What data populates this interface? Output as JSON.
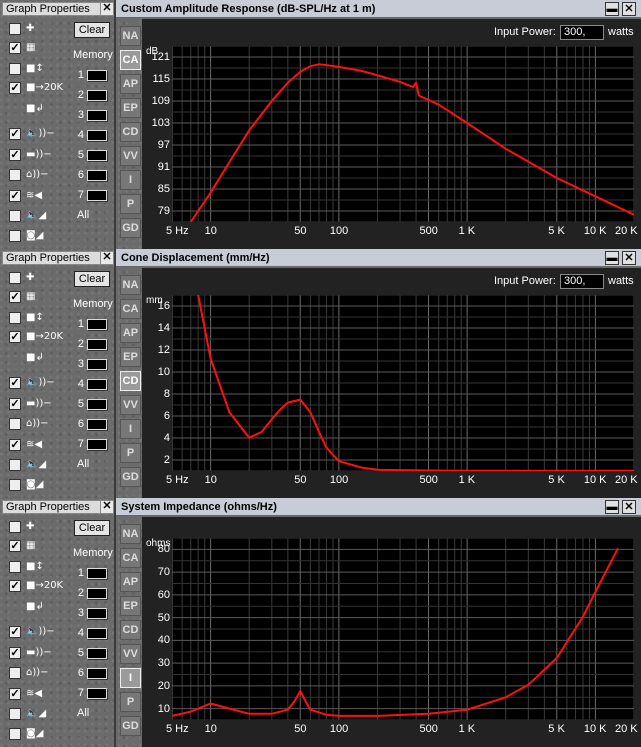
{
  "graph_properties": {
    "title": "Graph Properties",
    "close": "✕",
    "clear": "Clear",
    "memory": "Memory",
    "slots": [
      "1",
      "2",
      "3",
      "4",
      "5",
      "6",
      "7"
    ],
    "all": "All"
  },
  "tabs": [
    "NA",
    "CA",
    "AP",
    "EP",
    "CD",
    "VV",
    "I",
    "P",
    "GD"
  ],
  "window_buttons": {
    "minimize": "▬",
    "close": "✕"
  },
  "graph1": {
    "title": "Custom Amplitude Response (dB-SPL/Hz at 1 m)",
    "input_power_label": "Input Power:",
    "input_power_value": "300,",
    "unit": "watts",
    "yunit": "dB",
    "yticks": [
      "121",
      "115",
      "109",
      "103",
      "97",
      "91",
      "85",
      "79"
    ],
    "xticks": [
      "5 Hz",
      "10",
      "50",
      "100",
      "500",
      "1 K",
      "5 K",
      "10 K",
      "20 K"
    ]
  },
  "graph2": {
    "title": "Cone Displacement (mm/Hz)",
    "input_power_label": "Input Power:",
    "input_power_value": "300,",
    "unit": "watts",
    "yunit": "mm",
    "yticks": [
      "16",
      "14",
      "12",
      "10",
      "8",
      "6",
      "4",
      "2"
    ],
    "xticks": [
      "5 Hz",
      "10",
      "50",
      "100",
      "500",
      "1 K",
      "5 K",
      "10 K",
      "20 K"
    ]
  },
  "graph3": {
    "title": "System Impedance (ohms/Hz)",
    "yunit": "ohms",
    "yticks": [
      "80",
      "70",
      "60",
      "50",
      "40",
      "30",
      "20",
      "10"
    ],
    "xticks": [
      "5 Hz",
      "10",
      "50",
      "100",
      "500",
      "1 K",
      "5 K",
      "10 K",
      "20 K"
    ]
  },
  "colors": {
    "curve": "#ff1010",
    "grid": "#5a5a5a",
    "plot_bg": "#000000",
    "title_bar": "#c8ccd6"
  },
  "chart_data": [
    {
      "type": "line",
      "title": "Custom Amplitude Response (dB-SPL/Hz at 1 m)",
      "xlabel": "",
      "ylabel": "dB",
      "x_scale": "log",
      "xlim": [
        5,
        20000
      ],
      "ylim": [
        76,
        124
      ],
      "x": [
        7,
        10,
        15,
        20,
        30,
        40,
        50,
        60,
        70,
        80,
        100,
        150,
        200,
        300,
        380,
        400,
        420,
        600,
        1000,
        2000,
        5000,
        10000,
        20000
      ],
      "y": [
        76,
        84,
        94,
        101,
        109,
        114,
        117,
        118.5,
        119,
        118.8,
        118.3,
        117.2,
        116,
        114.2,
        112.8,
        114,
        110.5,
        108,
        103,
        96,
        88,
        83,
        78
      ]
    },
    {
      "type": "line",
      "title": "Cone Displacement (mm/Hz)",
      "xlabel": "",
      "ylabel": "mm",
      "x_scale": "log",
      "xlim": [
        5,
        20000
      ],
      "ylim": [
        0,
        18
      ],
      "x": [
        8,
        10,
        14,
        20,
        25,
        30,
        35,
        40,
        50,
        60,
        70,
        80,
        100,
        150,
        200,
        500,
        1000,
        5000,
        20000
      ],
      "y": [
        18,
        11.5,
        6,
        3.4,
        4,
        5.3,
        6.3,
        7,
        7.3,
        6,
        4,
        2.4,
        1,
        0.35,
        0.12,
        0.05,
        0.03,
        0.02,
        0.02
      ]
    },
    {
      "type": "line",
      "title": "System Impedance (ohms/Hz)",
      "xlabel": "",
      "ylabel": "ohms",
      "x_scale": "log",
      "xlim": [
        5,
        20000
      ],
      "ylim": [
        3,
        91
      ],
      "x": [
        5,
        7,
        10,
        14,
        20,
        30,
        40,
        45,
        50,
        55,
        60,
        80,
        100,
        200,
        500,
        1000,
        2000,
        3000,
        5000,
        8000,
        10000,
        15000
      ],
      "y": [
        5,
        7,
        11,
        8.5,
        6,
        6,
        8,
        12,
        17,
        12,
        8,
        5.5,
        5,
        5,
        6,
        8,
        14,
        20,
        33,
        53,
        65,
        86
      ]
    }
  ]
}
